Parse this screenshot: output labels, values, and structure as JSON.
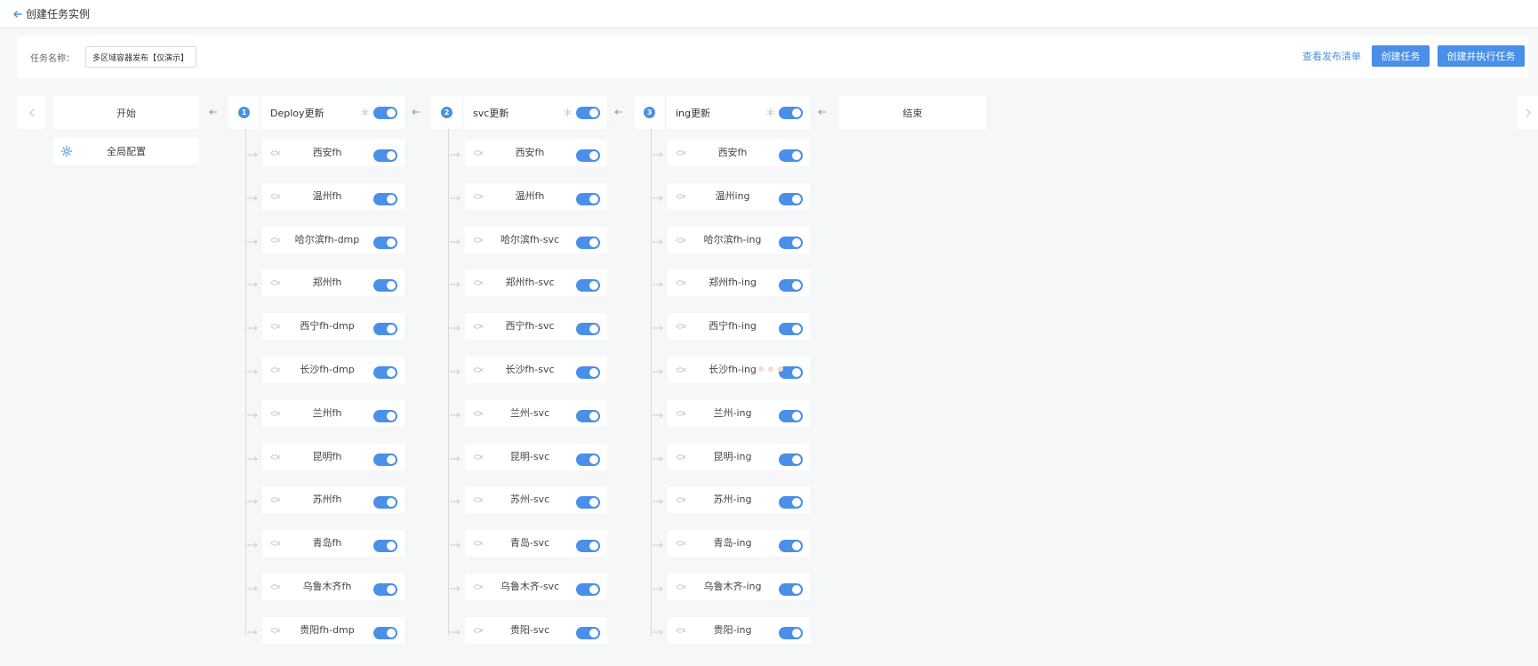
{
  "header": {
    "title": "创建任务实例"
  },
  "form": {
    "name_label": "任务名称：",
    "name_value": "多区域容器发布【仅演示】"
  },
  "actions": {
    "view_list": "查看发布清单",
    "create": "创建任务",
    "create_run": "创建并执行任务"
  },
  "flow": {
    "start_label": "开始",
    "end_label": "结束",
    "global_config_label": "全局配置",
    "stages": [
      {
        "number": "1",
        "name": "Deploy更新",
        "tasks": [
          "西安fh",
          "温州fh",
          "哈尔滨fh-dmp",
          "郑州fh",
          "西宁fh-dmp",
          "长沙fh-dmp",
          "兰州fh",
          "昆明fh",
          "苏州fh",
          "青岛fh",
          "乌鲁木齐fh",
          "贵阳fh-dmp"
        ]
      },
      {
        "number": "2",
        "name": "svc更新",
        "tasks": [
          "西安fh",
          "温州fh",
          "哈尔滨fh-svc",
          "郑州fh-svc",
          "西宁fh-svc",
          "长沙fh-svc",
          "兰州-svc",
          "昆明-svc",
          "苏州-svc",
          "青岛-svc",
          "乌鲁木齐-svc",
          "贵阳-svc"
        ]
      },
      {
        "number": "3",
        "name": "ing更新",
        "tasks": [
          "西安fh",
          "温州ing",
          "哈尔滨fh-ing",
          "郑州fh-ing",
          "西宁fh-ing",
          "长沙fh-ing",
          "兰州-ing",
          "昆明-ing",
          "苏州-ing",
          "青岛-ing",
          "乌鲁木齐-ing",
          "贵阳-ing"
        ]
      }
    ]
  },
  "colors": {
    "accent": "#4a8fe8",
    "link": "#4a90e2",
    "background": "#f5f7f8"
  }
}
